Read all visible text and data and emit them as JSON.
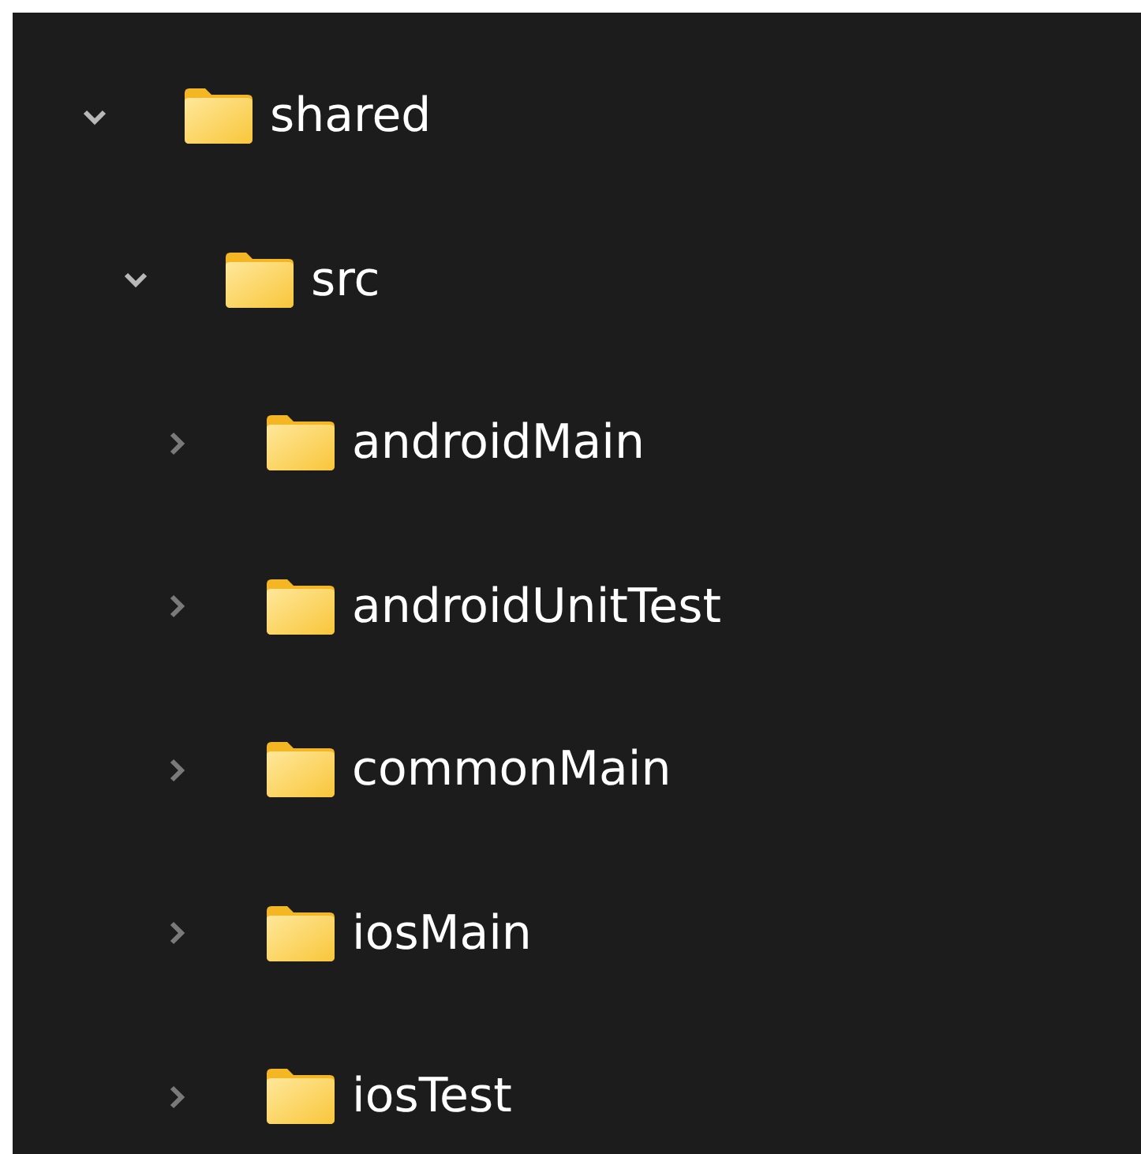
{
  "tree": [
    {
      "label": "shared",
      "expanded": true,
      "children": [
        {
          "label": "src",
          "expanded": true,
          "children": [
            {
              "label": "androidMain",
              "expanded": false
            },
            {
              "label": "androidUnitTest",
              "expanded": false
            },
            {
              "label": "commonMain",
              "expanded": false
            },
            {
              "label": "iosMain",
              "expanded": false
            },
            {
              "label": "iosTest",
              "expanded": false
            }
          ]
        }
      ]
    }
  ]
}
